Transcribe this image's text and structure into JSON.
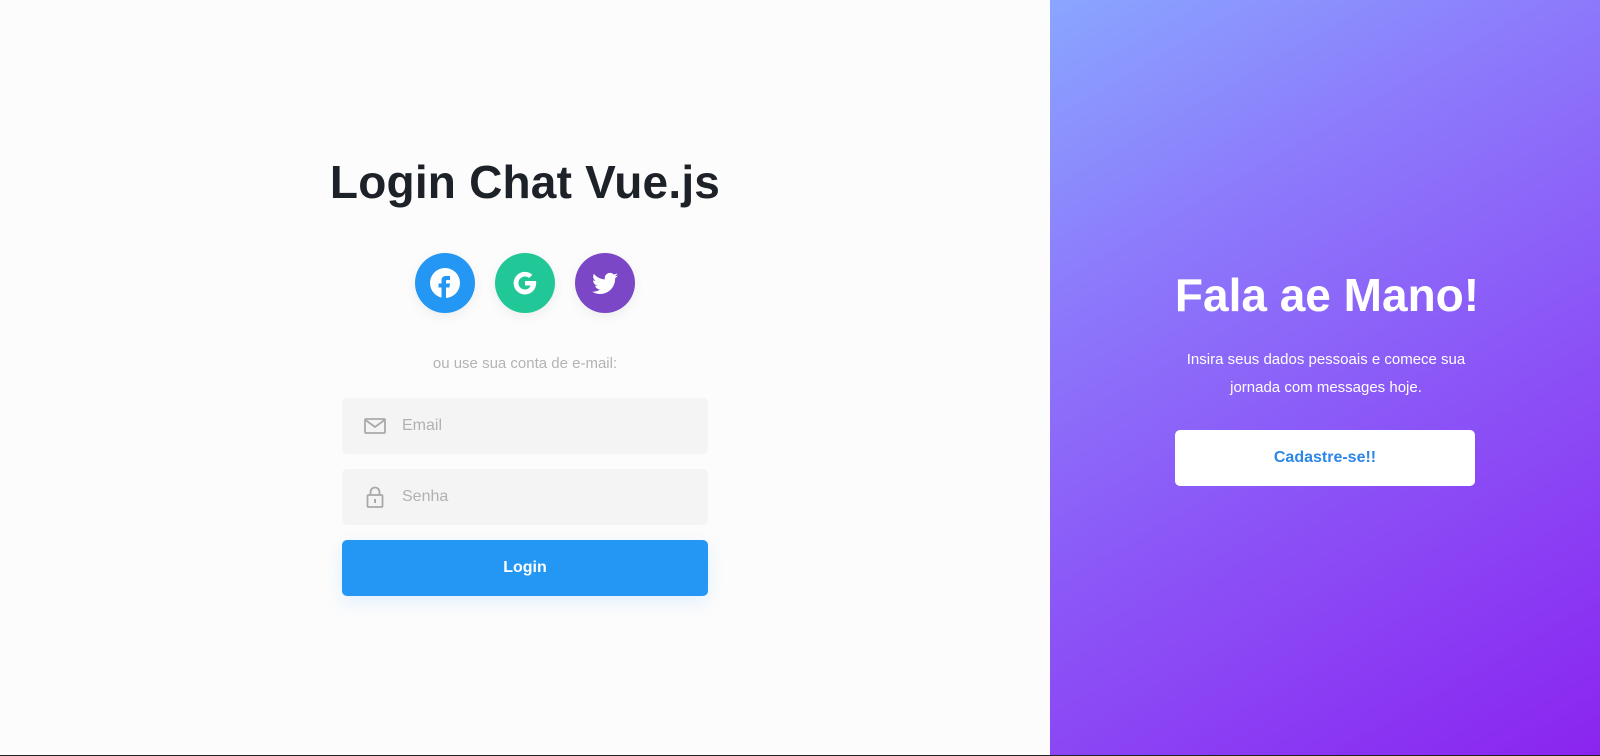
{
  "login": {
    "title": "Login Chat Vue.js",
    "social": [
      {
        "name": "facebook",
        "icon": "facebook-icon",
        "color": "#2397f3"
      },
      {
        "name": "google",
        "icon": "google-icon",
        "color": "#22c797"
      },
      {
        "name": "twitter",
        "icon": "twitter-icon",
        "color": "#7c47c7"
      }
    ],
    "divider_text": "ou use sua conta de e-mail:",
    "email_placeholder": "Email",
    "email_value": "",
    "password_placeholder": "Senha",
    "password_value": "",
    "login_label": "Login"
  },
  "signup": {
    "title": "Fala ae Mano!",
    "text": "Insira seus dados pessoais e comece sua jornada com messages hoje.",
    "button_label": "Cadastre-se!!"
  },
  "colors": {
    "primary": "#2397f3",
    "gradient_start": "#8aa6ff",
    "gradient_end": "#8a24f0",
    "title_text": "#1d2128"
  }
}
